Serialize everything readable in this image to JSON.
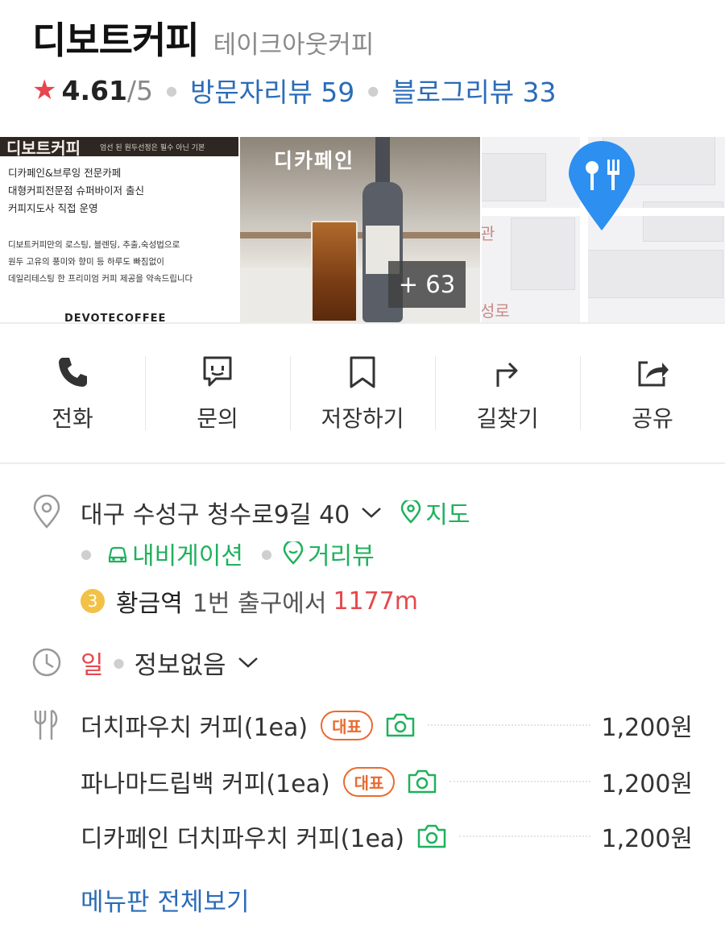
{
  "place": {
    "name": "디보트커피",
    "category": "테이크아웃커피",
    "rating": "4.61",
    "rating_max": "/5",
    "visitor_reviews": "방문자리뷰 59",
    "blog_reviews": "블로그리뷰 33"
  },
  "photos": {
    "photo1": {
      "banner_title": "디보트커피",
      "banner_sub": "엄선 된 원두선정은 필수 아닌 기본",
      "lines": [
        "디카페인&브루잉 전문카페",
        "대형커피전문점 슈퍼바이저 출신",
        "커피지도사 직접 운영"
      ],
      "paragraph": [
        "디보트커피만의 로스팅, 블렌딩, 추출,숙성법으로",
        "원두 고유의 풍미와 향미 등 하루도 빠짐없이",
        "데일리테스팅 한 프리미엄 커피 제공을 약속드립니다"
      ],
      "brand": "DEVOTECOFFEE"
    },
    "photo2": {
      "label": "디카페인",
      "more_count": "+ 63"
    },
    "map_texts": [
      "관",
      "성로"
    ]
  },
  "actions": [
    {
      "label": "전화",
      "icon": "phone-icon"
    },
    {
      "label": "문의",
      "icon": "chat-icon"
    },
    {
      "label": "저장하기",
      "icon": "bookmark-icon"
    },
    {
      "label": "길찾기",
      "icon": "directions-icon"
    },
    {
      "label": "공유",
      "icon": "share-icon"
    }
  ],
  "address": {
    "text": "대구 수성구 청수로9길 40",
    "map_link": "지도",
    "navigation_link": "내비게이션",
    "streetview_link": "거리뷰"
  },
  "subway": {
    "line": "3",
    "station": "황금역",
    "exit": "1번 출구에서",
    "distance": "1177m"
  },
  "hours": {
    "day": "일",
    "status": "정보없음"
  },
  "menu": {
    "items": [
      {
        "name": "더치파우치 커피(1ea)",
        "badge": "대표",
        "price": "1,200원"
      },
      {
        "name": "파나마드립백 커피(1ea)",
        "badge": "대표",
        "price": "1,200원"
      },
      {
        "name": "디카페인 더치파우치 커피(1ea)",
        "badge": "",
        "price": "1,200원"
      }
    ],
    "view_all": "메뉴판 전체보기"
  },
  "colors": {
    "link_blue": "#2b6cb8",
    "green": "#1fb15c",
    "red": "#e5484d",
    "badge_orange": "#ea6a2f",
    "map_pin_blue": "#2d8ff0",
    "subway_line_3": "#f2c146"
  }
}
